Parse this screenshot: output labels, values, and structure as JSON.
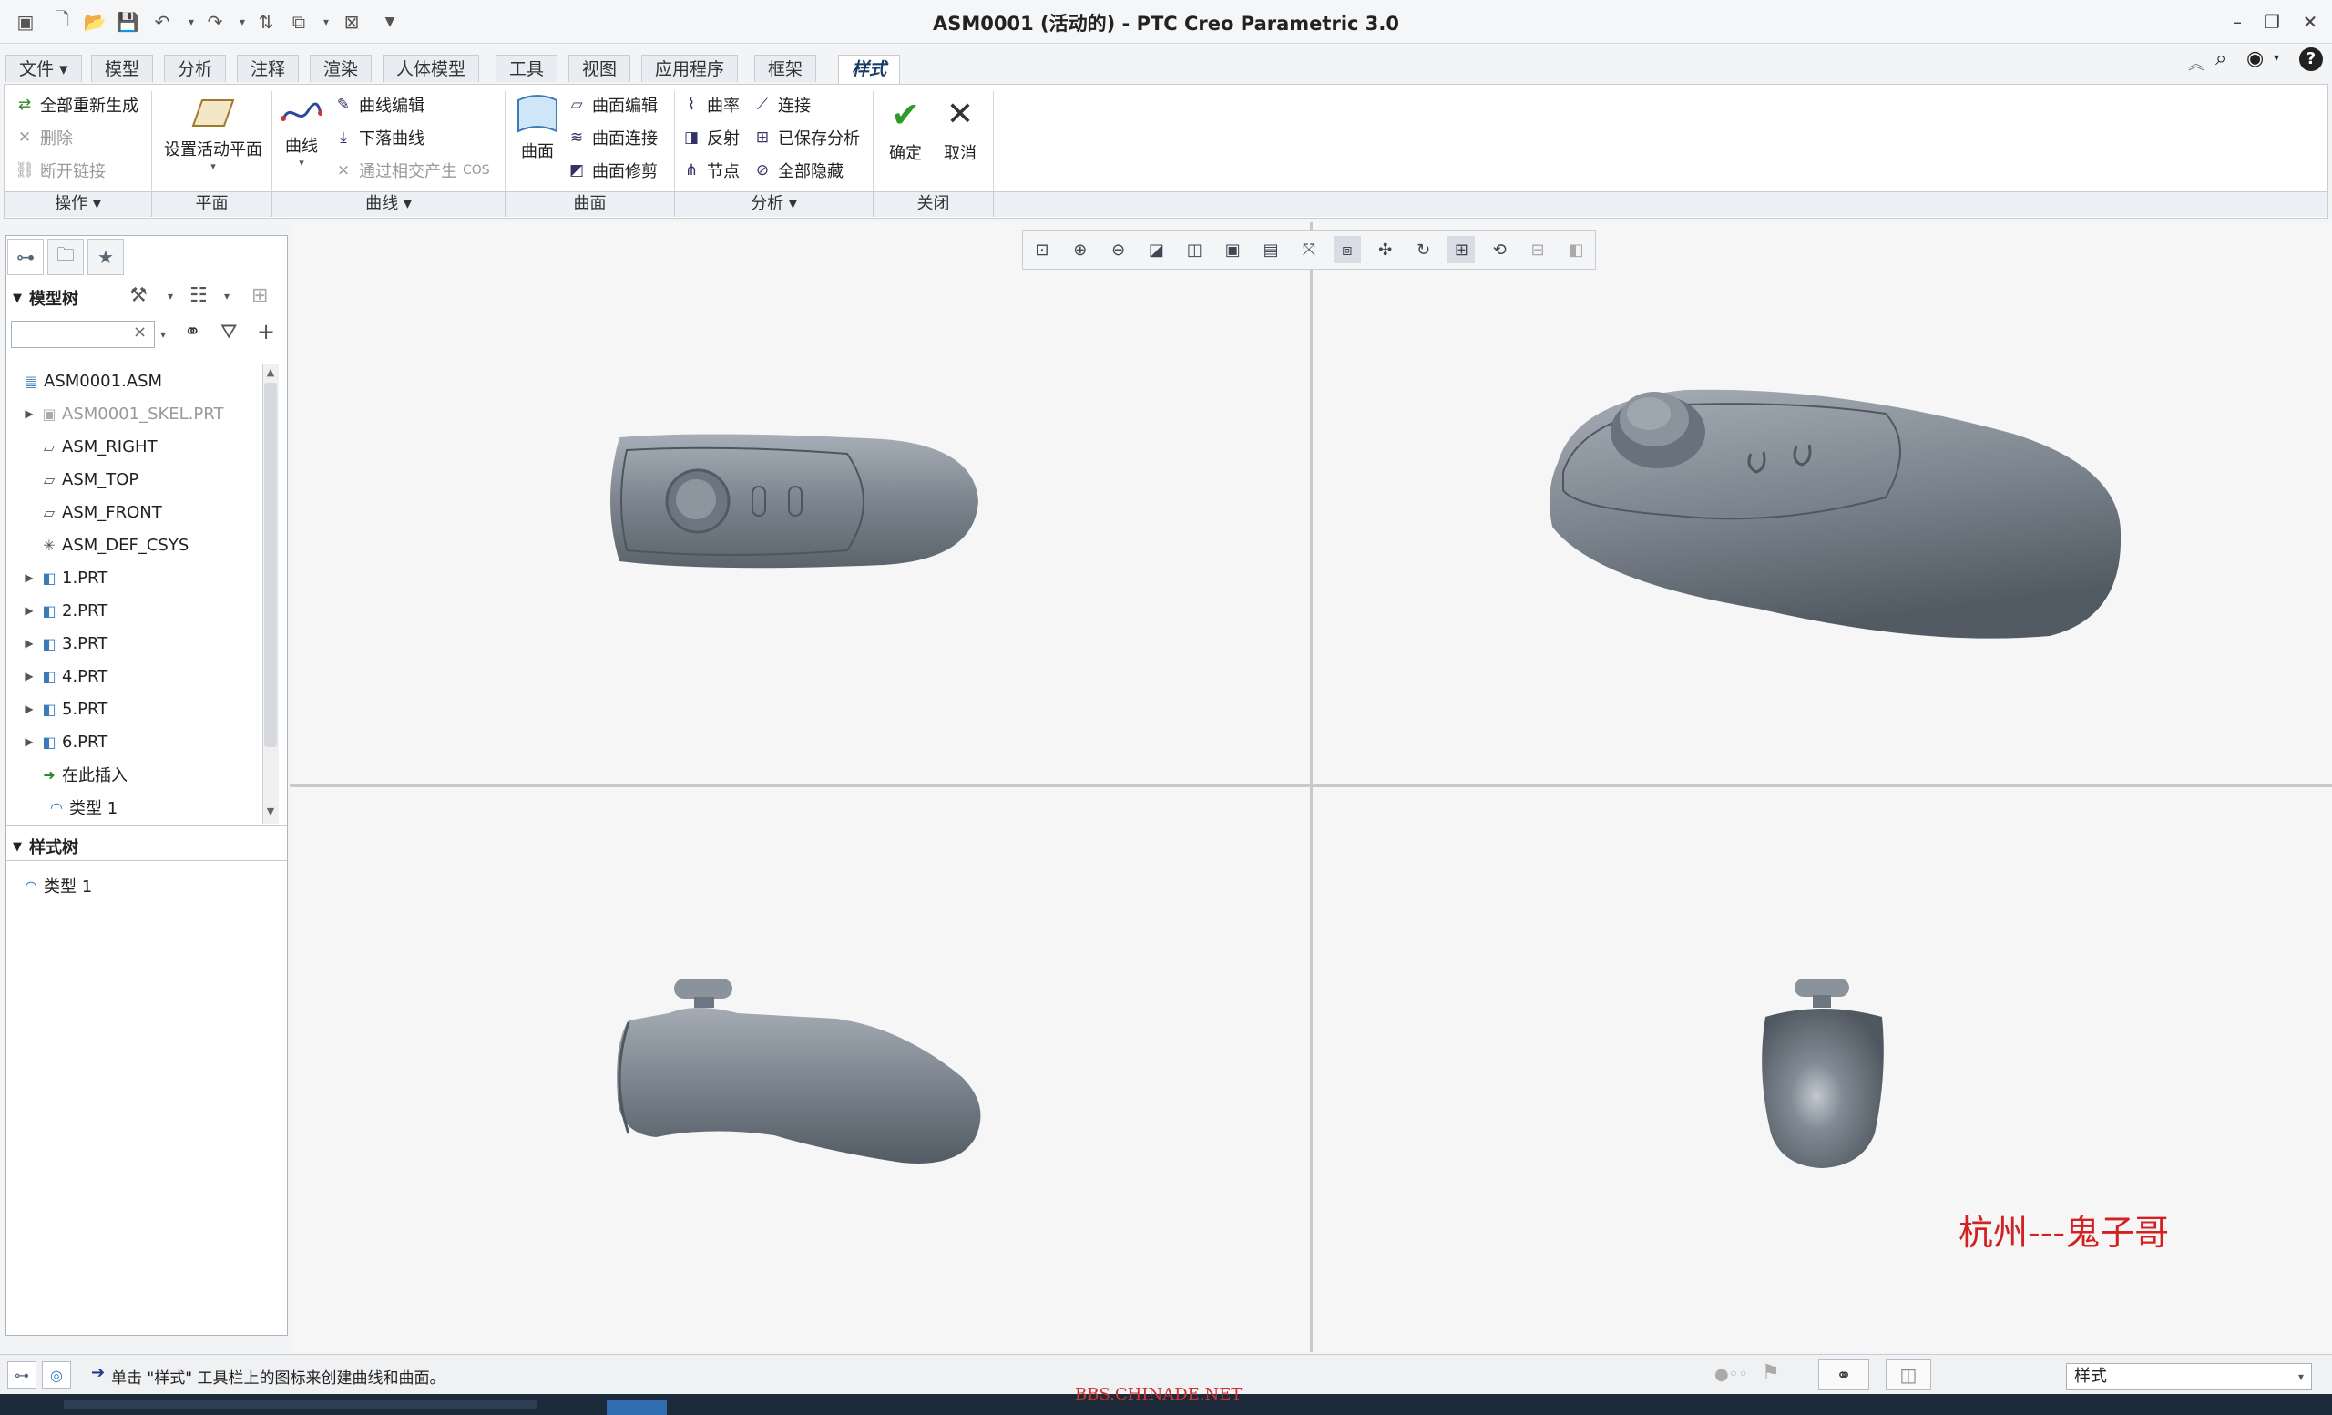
{
  "window": {
    "title": "ASM0001 (活动的) - PTC Creo Parametric 3.0"
  },
  "tabs": [
    {
      "label": "文件 ▾"
    },
    {
      "label": "模型"
    },
    {
      "label": "分析"
    },
    {
      "label": "注释"
    },
    {
      "label": "渲染"
    },
    {
      "label": "人体模型"
    },
    {
      "label": "工具"
    },
    {
      "label": "视图"
    },
    {
      "label": "应用程序"
    },
    {
      "label": "框架"
    },
    {
      "label": "样式"
    }
  ],
  "ribbon": {
    "ops": {
      "regen": "全部重新生成",
      "delete": "删除",
      "break_link": "断开链接"
    },
    "plane": {
      "set_active": "设置活动平面"
    },
    "curves": {
      "curve": "曲线",
      "curve_edit": "曲线编辑",
      "drop_curve": "下落曲线",
      "intersect": "通过相交产生",
      "cos": "COS"
    },
    "surfaces": {
      "surface": "曲面",
      "surface_edit": "曲面编辑",
      "surface_connect": "曲面连接",
      "surface_trim": "曲面修剪"
    },
    "analysis": {
      "curvature": "曲率",
      "connect": "连接",
      "reflect": "反射",
      "saved": "已保存分析",
      "node": "节点",
      "hide_all": "全部隐藏"
    },
    "close": {
      "ok": "确定",
      "cancel": "取消"
    },
    "groups": {
      "ops": "操作 ▾",
      "plane": "平面",
      "curves": "曲线 ▾",
      "surfaces": "曲面",
      "analysis": "分析 ▾",
      "close": "关闭"
    }
  },
  "model_tree": {
    "header": "模型树",
    "items": [
      {
        "label": "ASM0001.ASM"
      },
      {
        "label": "ASM0001_SKEL.PRT"
      },
      {
        "label": "ASM_RIGHT"
      },
      {
        "label": "ASM_TOP"
      },
      {
        "label": "ASM_FRONT"
      },
      {
        "label": "ASM_DEF_CSYS"
      },
      {
        "label": "1.PRT"
      },
      {
        "label": "2.PRT"
      },
      {
        "label": "3.PRT"
      },
      {
        "label": "4.PRT"
      },
      {
        "label": "5.PRT"
      },
      {
        "label": "6.PRT"
      },
      {
        "label": "在此插入"
      },
      {
        "label": "类型 1"
      }
    ]
  },
  "style_tree": {
    "header": "样式树",
    "items": [
      {
        "label": "类型 1"
      }
    ]
  },
  "viewport": {
    "watermark": "杭州---鬼子哥"
  },
  "status": {
    "message": "单击 \"样式\" 工具栏上的图标来创建曲线和曲面。",
    "filter_value": "样式",
    "bbs_text": "BBS.CHINADE.NET"
  },
  "colors": {
    "model": "#7e8793",
    "watermark": "#d42020",
    "accept": "#2e9a2e"
  }
}
